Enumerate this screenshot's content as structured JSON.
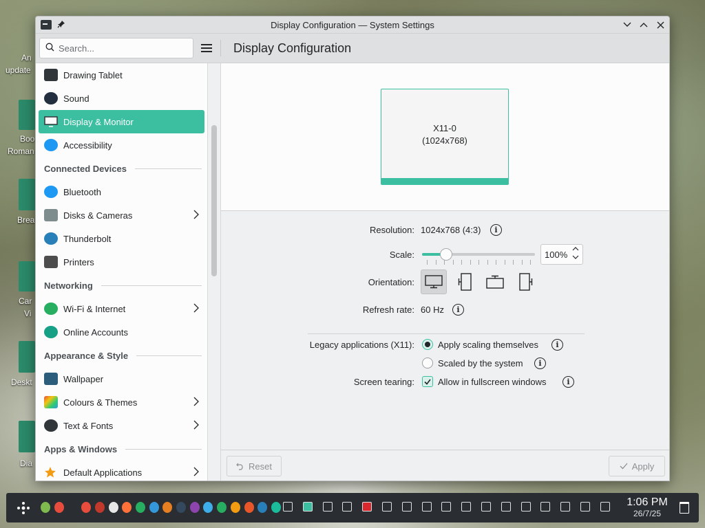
{
  "desktop": {
    "labels": [
      "An",
      "update",
      "Boo",
      "Roman",
      "Brea",
      "Car",
      "Vi",
      "Deskt",
      "Dia"
    ]
  },
  "window": {
    "title": "Display Configuration — System Settings"
  },
  "toolbar": {
    "search_placeholder": "Search...",
    "page_title": "Display Configuration"
  },
  "sidebar": {
    "items": [
      {
        "type": "item",
        "label": "Drawing Tablet",
        "icon": "drawing-tablet-icon",
        "color": "#31363b",
        "chevron": false,
        "active": false
      },
      {
        "type": "item",
        "label": "Sound",
        "icon": "speaker-icon",
        "color": "#232f3e",
        "chevron": false,
        "active": false
      },
      {
        "type": "item",
        "label": "Display & Monitor",
        "icon": "monitor-icon",
        "color": "#31363b",
        "chevron": false,
        "active": true
      },
      {
        "type": "item",
        "label": "Accessibility",
        "icon": "accessibility-icon",
        "color": "#1d99f3",
        "chevron": false,
        "active": false
      },
      {
        "type": "section",
        "label": "Connected Devices"
      },
      {
        "type": "item",
        "label": "Bluetooth",
        "icon": "bluetooth-icon",
        "color": "#1d99f3",
        "chevron": false,
        "active": false
      },
      {
        "type": "item",
        "label": "Disks & Cameras",
        "icon": "disk-icon",
        "color": "#7f8c8d",
        "chevron": true,
        "active": false
      },
      {
        "type": "item",
        "label": "Thunderbolt",
        "icon": "thunderbolt-icon",
        "color": "#2980b9",
        "chevron": false,
        "active": false
      },
      {
        "type": "item",
        "label": "Printers",
        "icon": "printer-icon",
        "color": "#4d4d4d",
        "chevron": false,
        "active": false
      },
      {
        "type": "section",
        "label": "Networking"
      },
      {
        "type": "item",
        "label": "Wi-Fi & Internet",
        "icon": "globe-icon",
        "color": "#27ae60",
        "chevron": true,
        "active": false
      },
      {
        "type": "item",
        "label": "Online Accounts",
        "icon": "online-accounts-icon",
        "color": "#16a085",
        "chevron": false,
        "active": false
      },
      {
        "type": "section",
        "label": "Appearance & Style"
      },
      {
        "type": "item",
        "label": "Wallpaper",
        "icon": "wallpaper-icon",
        "color": "#2c5d7a",
        "chevron": false,
        "active": false
      },
      {
        "type": "item",
        "label": "Colours & Themes",
        "icon": "colours-icon",
        "color": "#e74c3c",
        "chevron": true,
        "active": false
      },
      {
        "type": "item",
        "label": "Text & Fonts",
        "icon": "fonts-icon",
        "color": "#31363b",
        "chevron": true,
        "active": false
      },
      {
        "type": "section",
        "label": "Apps & Windows"
      },
      {
        "type": "item",
        "label": "Default Applications",
        "icon": "star-icon",
        "color": "#f39c12",
        "chevron": true,
        "active": false
      }
    ]
  },
  "preview": {
    "output_name": "X11-0",
    "output_res": "(1024x768)"
  },
  "settings": {
    "resolution_label": "Resolution:",
    "resolution_value": "1024x768 (4:3)",
    "scale_label": "Scale:",
    "scale_value": "100%",
    "scale_fraction": 0.2,
    "orientation_label": "Orientation:",
    "orientations": [
      "landscape",
      "portrait-left",
      "landscape-flipped",
      "portrait-right"
    ],
    "orientation_selected": 0,
    "refresh_label": "Refresh rate:",
    "refresh_value": "60 Hz",
    "legacy_label": "Legacy applications (X11):",
    "legacy_option_1": "Apply scaling themselves",
    "legacy_option_2": "Scaled by the system",
    "legacy_selected": 1,
    "tearing_label": "Screen tearing:",
    "tearing_option": "Allow in fullscreen windows",
    "tearing_checked": true
  },
  "footer": {
    "reset_label": "Reset",
    "apply_label": "Apply"
  },
  "taskbar": {
    "time": "1:06 PM",
    "date": "26/7/25"
  },
  "colors": {
    "accent": "#3bbfa0",
    "taskbar": "#2a2e32"
  }
}
